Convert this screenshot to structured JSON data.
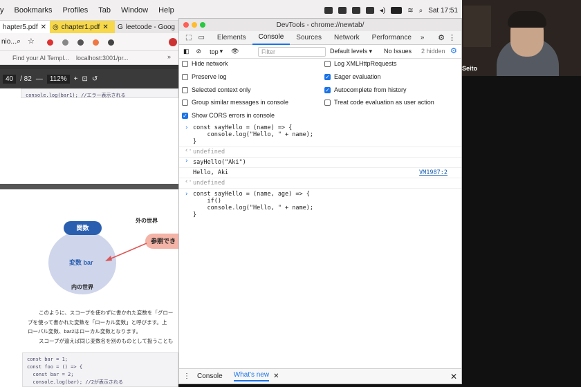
{
  "menubar": {
    "items": [
      "y",
      "Bookmarks",
      "Profiles",
      "Tab",
      "Window",
      "Help"
    ],
    "clock": "Sat  17:51"
  },
  "browser": {
    "tabs": [
      "hapter5.pdf",
      "chapter1.pdf",
      "leetcode - Goog"
    ],
    "omnibox": "nio...",
    "bookmarks": [
      "Find your AI Templ...",
      "localhost:3001/pr..."
    ],
    "pdf": {
      "page": "40",
      "total": "/ 82",
      "zoom": "112%",
      "code_top": "console.log(bar1); //エラー表示される",
      "labels": {
        "function": "関数",
        "outer": "外の世界",
        "variable": "変数 bar",
        "inner": "内の世界",
        "ref": "参照でき"
      },
      "para": [
        "このように、スコープを使わずに書かれた変数を「グロー",
        "プを使って書かれた変数を「ローカル変数」と呼びます。上",
        "ローバル変数、bar2はローカル変数となります。",
        "スコープが違えば同じ変数名を別のものとして扱うことも"
      ],
      "code_bottom": [
        "const bar = 1;",
        "const foo = () => {",
        "  const bar = 2;",
        "  console.log(bar); //2が表示される"
      ]
    }
  },
  "devtools": {
    "title": "DevTools - chrome://newtab/",
    "tabs": [
      "Elements",
      "Console",
      "Sources",
      "Network",
      "Performance"
    ],
    "active_tab": "Console",
    "context": "top",
    "filter_placeholder": "Filter",
    "levels": "Default levels ▾",
    "issues": "No Issues",
    "hidden": "2 hidden",
    "settings": [
      {
        "label": "Hide network",
        "on": false
      },
      {
        "label": "Log XMLHttpRequests",
        "on": false
      },
      {
        "label": "Preserve log",
        "on": false
      },
      {
        "label": "Eager evaluation",
        "on": true
      },
      {
        "label": "Selected context only",
        "on": false
      },
      {
        "label": "Autocomplete from history",
        "on": true
      },
      {
        "label": "Group similar messages in console",
        "on": false
      },
      {
        "label": "Treat code evaluation as user action",
        "on": false
      },
      {
        "label": "Show CORS errors in console",
        "on": true
      }
    ],
    "console": {
      "e1": [
        "const sayHello = (name) => {",
        "    console.log(\"Hello, \" + name);",
        "}"
      ],
      "r1": "undefined",
      "e2": "sayHello(\"Aki\")",
      "out": "Hello, Aki",
      "src": "VM1987:2",
      "r2": "undefined",
      "e3": [
        "const sayHello = (name, age) => {",
        "    if()",
        "    console.log(\"Hello, \" + name);",
        "}"
      ]
    },
    "drawer": [
      "Console",
      "What's new"
    ]
  },
  "webcam": {
    "name": "Seito"
  }
}
